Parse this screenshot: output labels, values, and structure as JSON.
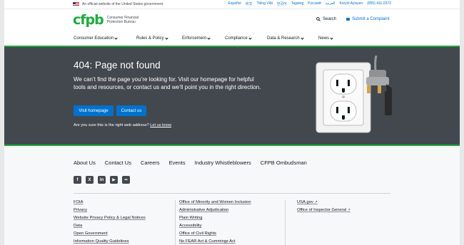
{
  "gov_banner": {
    "text": "An official website of the United States government",
    "languages": [
      "Español",
      "中文",
      "Tiếng Việt",
      "한국어",
      "Tagalog",
      "Русский",
      "العربية",
      "Kreyòl Ayisyen",
      "(855) 411-2372"
    ]
  },
  "header": {
    "logo": "cfpb",
    "logo_text": "Consumer Financial Protection Bureau",
    "search_label": "Search",
    "complaint_label": "Submit a Complaint"
  },
  "nav": {
    "items": [
      "Consumer Education",
      "Rules & Policy",
      "Enforcement",
      "Compliance",
      "Data & Research",
      "News"
    ]
  },
  "hero": {
    "title": "404: Page not found",
    "lead": "We can’t find the page you’re looking for. Visit our homepage for helpful tools and resources, or contact us and we’ll point you in the right direction.",
    "btn_home": "Visit homepage",
    "btn_contact": "Contact us",
    "question": "Are you sure this is the right web address?",
    "learn_link": "Let us know"
  },
  "footer": {
    "links": [
      "About Us",
      "Contact Us",
      "Careers",
      "Events",
      "Industry Whistleblowers",
      "CFPB Ombudsman"
    ],
    "social": [
      "f",
      "X",
      "in",
      "▶",
      "••"
    ],
    "col1": [
      "FOIA",
      "Privacy",
      "Website Privacy Policy & Legal Notices",
      "Data",
      "Open Government",
      "Information Quality Guidelines"
    ],
    "col2": [
      "Office of Minority and Women Inclusion",
      "Administrative Adjudication",
      "Plain Writing",
      "Accessibility",
      "Office of Civil Rights",
      "No FEAR Act & Cummings Act"
    ],
    "col3": [
      "USA.gov",
      "Office of Inspector General"
    ],
    "ext_icon": "↗"
  },
  "colors": {
    "brand_green": "#20aa3f",
    "dark_gray": "#43484e",
    "pacific_blue": "#0072ce"
  }
}
